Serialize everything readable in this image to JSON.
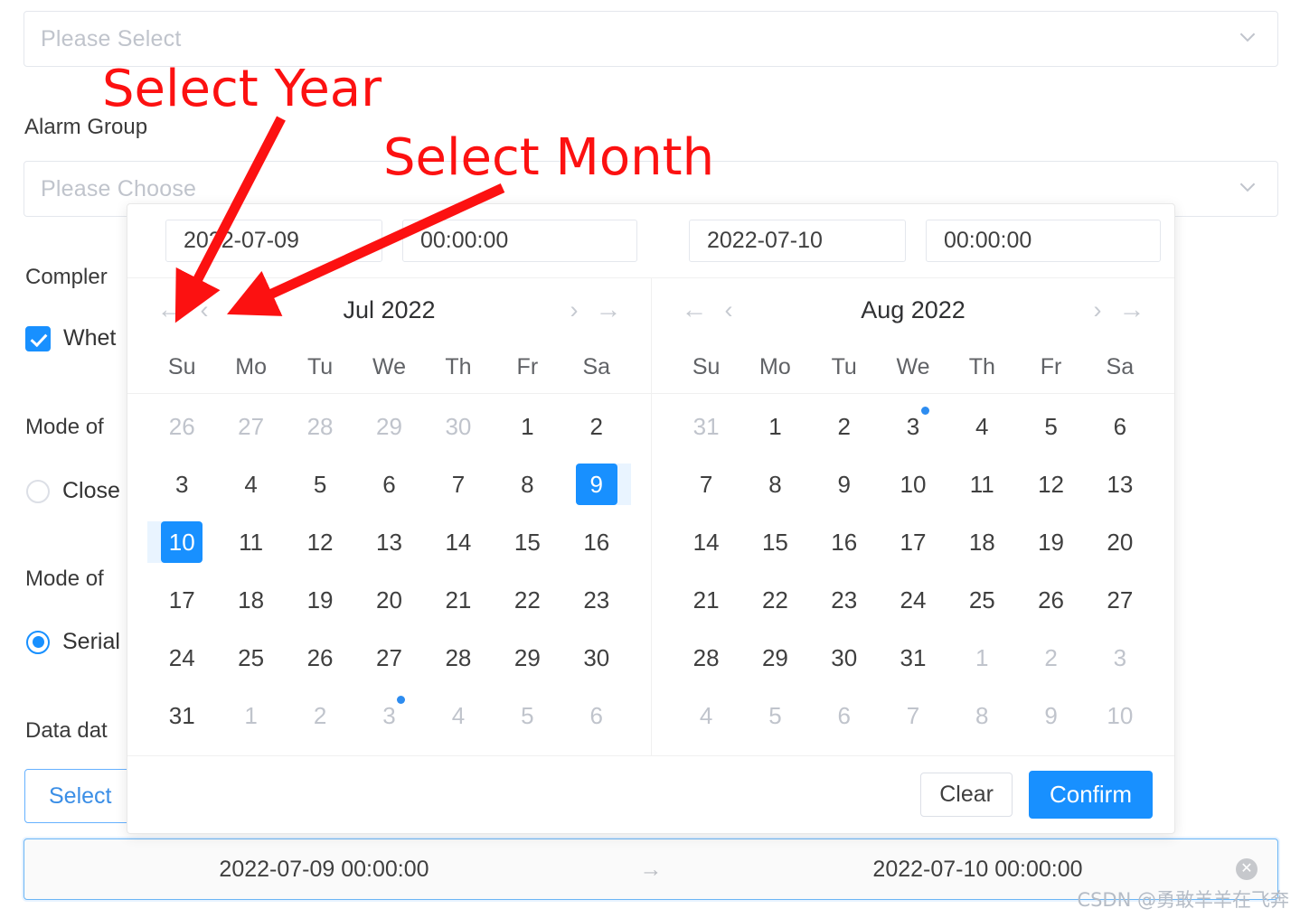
{
  "background_form": {
    "top_select": {
      "placeholder": "Please Select",
      "caret": "chevron-down-icon"
    },
    "alarm_group_label": "Alarm Group",
    "alarm_group_select": {
      "placeholder": "Please Choose",
      "caret": "chevron-down-icon"
    },
    "complete_label": "Compler",
    "whether_checkbox": {
      "label": "Whet",
      "checked": true
    },
    "mode_of_label_1": "Mode of",
    "close_radio": {
      "label": "Close",
      "selected": false
    },
    "mode_of_label_2": "Mode of",
    "serial_radio": {
      "label": "Serial",
      "selected": true
    },
    "data_date_label": "Data dat",
    "select_button": "Select"
  },
  "range_input": {
    "start": "2022-07-09 00:00:00",
    "separator": "→",
    "end": "2022-07-10 00:00:00",
    "clear_icon": "close-circle-icon"
  },
  "picker": {
    "header": {
      "start_date": "2022-07-09",
      "start_time": "00:00:00",
      "end_date": "2022-07-10",
      "end_time": "00:00:00"
    },
    "nav_icons": {
      "prev_year": "←",
      "prev_month": "‹",
      "next_month": "›",
      "next_year": "→"
    },
    "weekdays": [
      "Su",
      "Mo",
      "Tu",
      "We",
      "Th",
      "Fr",
      "Sa"
    ],
    "left": {
      "title": "Jul 2022",
      "days": [
        {
          "n": "26",
          "muted": true
        },
        {
          "n": "27",
          "muted": true
        },
        {
          "n": "28",
          "muted": true
        },
        {
          "n": "29",
          "muted": true
        },
        {
          "n": "30",
          "muted": true
        },
        {
          "n": "1"
        },
        {
          "n": "2"
        },
        {
          "n": "3"
        },
        {
          "n": "4"
        },
        {
          "n": "5"
        },
        {
          "n": "6"
        },
        {
          "n": "7"
        },
        {
          "n": "8"
        },
        {
          "n": "9",
          "selected": true,
          "range": "right"
        },
        {
          "n": "10",
          "selected": true,
          "range": "left"
        },
        {
          "n": "11"
        },
        {
          "n": "12"
        },
        {
          "n": "13"
        },
        {
          "n": "14"
        },
        {
          "n": "15"
        },
        {
          "n": "16"
        },
        {
          "n": "17"
        },
        {
          "n": "18"
        },
        {
          "n": "19"
        },
        {
          "n": "20"
        },
        {
          "n": "21"
        },
        {
          "n": "22"
        },
        {
          "n": "23"
        },
        {
          "n": "24"
        },
        {
          "n": "25"
        },
        {
          "n": "26"
        },
        {
          "n": "27"
        },
        {
          "n": "28"
        },
        {
          "n": "29"
        },
        {
          "n": "30"
        },
        {
          "n": "31"
        },
        {
          "n": "1",
          "muted": true
        },
        {
          "n": "2",
          "muted": true
        },
        {
          "n": "3",
          "muted": true,
          "today": true
        },
        {
          "n": "4",
          "muted": true
        },
        {
          "n": "5",
          "muted": true
        },
        {
          "n": "6",
          "muted": true
        }
      ]
    },
    "right": {
      "title": "Aug 2022",
      "days": [
        {
          "n": "31",
          "muted": true
        },
        {
          "n": "1"
        },
        {
          "n": "2"
        },
        {
          "n": "3",
          "today": true
        },
        {
          "n": "4"
        },
        {
          "n": "5"
        },
        {
          "n": "6"
        },
        {
          "n": "7"
        },
        {
          "n": "8"
        },
        {
          "n": "9"
        },
        {
          "n": "10"
        },
        {
          "n": "11"
        },
        {
          "n": "12"
        },
        {
          "n": "13"
        },
        {
          "n": "14"
        },
        {
          "n": "15"
        },
        {
          "n": "16"
        },
        {
          "n": "17"
        },
        {
          "n": "18"
        },
        {
          "n": "19"
        },
        {
          "n": "20"
        },
        {
          "n": "21"
        },
        {
          "n": "22"
        },
        {
          "n": "23"
        },
        {
          "n": "24"
        },
        {
          "n": "25"
        },
        {
          "n": "26"
        },
        {
          "n": "27"
        },
        {
          "n": "28"
        },
        {
          "n": "29"
        },
        {
          "n": "30"
        },
        {
          "n": "31"
        },
        {
          "n": "1",
          "muted": true
        },
        {
          "n": "2",
          "muted": true
        },
        {
          "n": "3",
          "muted": true
        },
        {
          "n": "4",
          "muted": true
        },
        {
          "n": "5",
          "muted": true
        },
        {
          "n": "6",
          "muted": true
        },
        {
          "n": "7",
          "muted": true
        },
        {
          "n": "8",
          "muted": true
        },
        {
          "n": "9",
          "muted": true
        },
        {
          "n": "10",
          "muted": true
        }
      ]
    },
    "footer": {
      "clear": "Clear",
      "confirm": "Confirm"
    }
  },
  "annotations": {
    "select_year": "Select Year",
    "select_month": "Select Month"
  },
  "watermark": "CSDN @勇敢羊羊在飞奔",
  "colors": {
    "accent": "#1890ff",
    "range_fill": "#e9f4ff",
    "annotation_red": "#fc1111",
    "muted_text": "#c0c4cc",
    "border": "#e4e7ed"
  }
}
